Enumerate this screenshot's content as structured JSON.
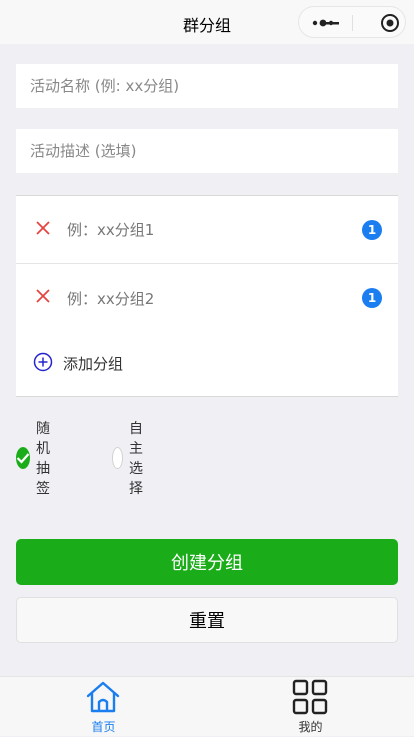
{
  "nav": {
    "title": "群分组"
  },
  "form": {
    "name_placeholder": "活动名称 (例: xx分组)",
    "desc_placeholder": "活动描述 (选填)"
  },
  "groups": {
    "items": [
      {
        "label": "例：xx分组1",
        "count": "1"
      },
      {
        "label": "例：xx分组2",
        "count": "1"
      }
    ],
    "add_label": "添加分组"
  },
  "mode": {
    "options": [
      {
        "label": "随机抽签",
        "selected": true
      },
      {
        "label": "自主选择",
        "selected": false
      }
    ]
  },
  "actions": {
    "create_label": "创建分组",
    "reset_label": "重置"
  },
  "tabbar": {
    "items": [
      {
        "label": "首页",
        "icon": "home-icon",
        "active": true
      },
      {
        "label": "我的",
        "icon": "grid-icon",
        "active": false
      }
    ]
  },
  "colors": {
    "primary_green": "#1aad19",
    "badge_blue": "#1a7ef0",
    "remove_red": "#e64340",
    "add_blue": "#2525d0",
    "tab_active": "#1a7ef0",
    "tab_inactive": "#333333"
  }
}
